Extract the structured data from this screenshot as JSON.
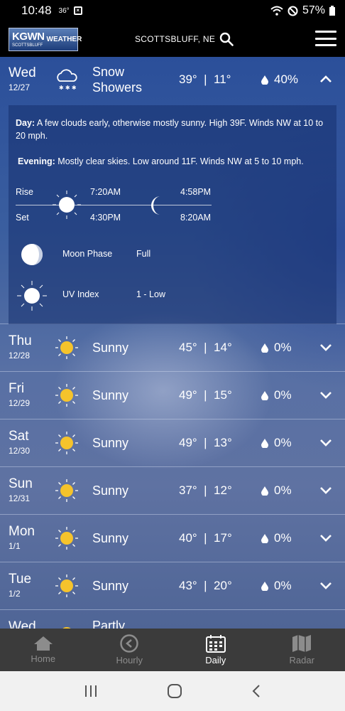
{
  "status": {
    "time": "10:48",
    "temp": "36°",
    "battery": "57%"
  },
  "header": {
    "logo_main": "KGWN",
    "logo_sub": "SCOTTSBLUFF",
    "logo_weather": "WEATHER",
    "location": "SCOTTSBLUFF, NE"
  },
  "days": [
    {
      "name": "Wed",
      "date": "12/27",
      "condition": "Snow Showers",
      "hi": "39°",
      "lo": "11°",
      "precip": "40%",
      "icon": "snow-cloud-icon",
      "expanded": true
    },
    {
      "name": "Thu",
      "date": "12/28",
      "condition": "Sunny",
      "hi": "45°",
      "lo": "14°",
      "precip": "0%",
      "icon": "sun-icon"
    },
    {
      "name": "Fri",
      "date": "12/29",
      "condition": "Sunny",
      "hi": "49°",
      "lo": "15°",
      "precip": "0%",
      "icon": "sun-icon"
    },
    {
      "name": "Sat",
      "date": "12/30",
      "condition": "Sunny",
      "hi": "49°",
      "lo": "13°",
      "precip": "0%",
      "icon": "sun-icon"
    },
    {
      "name": "Sun",
      "date": "12/31",
      "condition": "Sunny",
      "hi": "37°",
      "lo": "12°",
      "precip": "0%",
      "icon": "sun-icon"
    },
    {
      "name": "Mon",
      "date": "1/1",
      "condition": "Sunny",
      "hi": "40°",
      "lo": "17°",
      "precip": "0%",
      "icon": "sun-icon"
    },
    {
      "name": "Tue",
      "date": "1/2",
      "condition": "Sunny",
      "hi": "43°",
      "lo": "20°",
      "precip": "0%",
      "icon": "sun-icon"
    },
    {
      "name": "Wed",
      "date": "",
      "condition": "Partly",
      "hi": "",
      "lo": "",
      "precip": "",
      "icon": "partly-sunny-icon"
    }
  ],
  "detail": {
    "day_label": "Day:",
    "day_text": "A few clouds early, otherwise mostly sunny. High 39F. Winds NW at 10 to 20 mph.",
    "evening_label": "Evening:",
    "evening_text": "Mostly clear skies. Low around 11F. Winds NW at 5 to 10 mph.",
    "rise_label": "Rise",
    "set_label": "Set",
    "sunrise": "7:20AM",
    "sunset": "4:30PM",
    "moonrise": "4:58PM",
    "moonset": "8:20AM",
    "moon_phase_label": "Moon Phase",
    "moon_phase": "Full",
    "uv_label": "UV Index",
    "uv_value": "1 - Low"
  },
  "nav": {
    "home": "Home",
    "hourly": "Hourly",
    "daily": "Daily",
    "radar": "Radar"
  }
}
